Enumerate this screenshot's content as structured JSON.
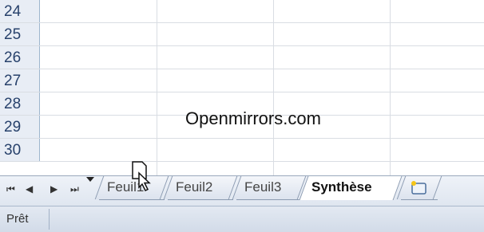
{
  "watermark": "Openmirrors.com",
  "rows": [
    "24",
    "25",
    "26",
    "27",
    "28",
    "29",
    "30"
  ],
  "nav": {
    "first": "⏮",
    "prev": "◀",
    "next": "▶",
    "last": "⏭"
  },
  "tabs": [
    {
      "label": "Feuil1",
      "active": false
    },
    {
      "label": "Feuil2",
      "active": false
    },
    {
      "label": "Feuil3",
      "active": false
    },
    {
      "label": "Synthèse",
      "active": true
    }
  ],
  "status": {
    "text": "Prêt"
  },
  "icons": {
    "new_sheet": "insert-worksheet-icon",
    "cursor": "mouse-pointer-icon",
    "drag_doc": "drag-document-icon"
  }
}
